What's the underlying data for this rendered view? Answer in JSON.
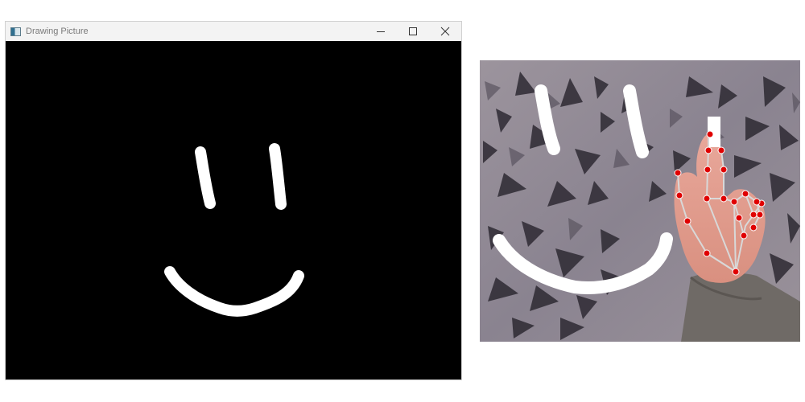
{
  "window": {
    "title": "Drawing Picture",
    "icon": "app-window-icon",
    "controls": [
      {
        "name": "minimize-button",
        "icon": "minimize-icon"
      },
      {
        "name": "maximize-button",
        "icon": "maximize-icon"
      },
      {
        "name": "close-button",
        "icon": "close-icon"
      }
    ]
  },
  "canvas": {
    "background": "#000000",
    "stroke_color": "#ffffff",
    "drawing": "smiley-face-strokes"
  },
  "camera_view": {
    "overlay_stroke_color": "#ffffff",
    "landmark_color": "#e00000",
    "connection_color": "#d8d8d8",
    "cursor_marker_color": "#ffffff"
  }
}
